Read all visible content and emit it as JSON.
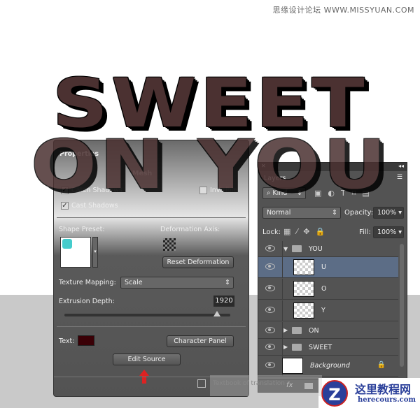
{
  "watermark": "思缘设计论坛 WWW.MISSYUAN.COM",
  "artwork": {
    "line1": "SWEET",
    "line2": "ON YOU"
  },
  "properties": {
    "title": "Properties",
    "tab_mesh": "Mesh",
    "catch_shadows": "Catch Shadows",
    "invisible": "Invisible",
    "cast_shadows": "Cast Shadows",
    "shape_preset": "Shape Preset:",
    "deformation_axis": "Deformation Axis:",
    "reset_deformation": "Reset Deformation",
    "texture_mapping": "Texture Mapping:",
    "texture_value": "Scale",
    "extrusion_depth": "Extrusion Depth:",
    "extrusion_value": "1920",
    "extrusion_fraction": 0.92,
    "text_label": "Text:",
    "text_color": "#3a0006",
    "character_panel": "Character Panel",
    "edit_source": "Edit Source"
  },
  "layers": {
    "tab": "Layers",
    "kind": "Kind",
    "blend": "Normal",
    "opacity_label": "Opacity:",
    "opacity": "100%",
    "lock_label": "Lock:",
    "fill_label": "Fill:",
    "fill": "100%",
    "items": [
      {
        "name": "YOU"
      },
      {
        "name": "U"
      },
      {
        "name": "O"
      },
      {
        "name": "Y"
      },
      {
        "name": "ON"
      },
      {
        "name": "SWEET"
      },
      {
        "name": "Background"
      }
    ],
    "fx": "fx"
  },
  "tooltip": "Textbook of translation",
  "logo": {
    "cn": "这里教程网",
    "url": "herecours.com"
  }
}
